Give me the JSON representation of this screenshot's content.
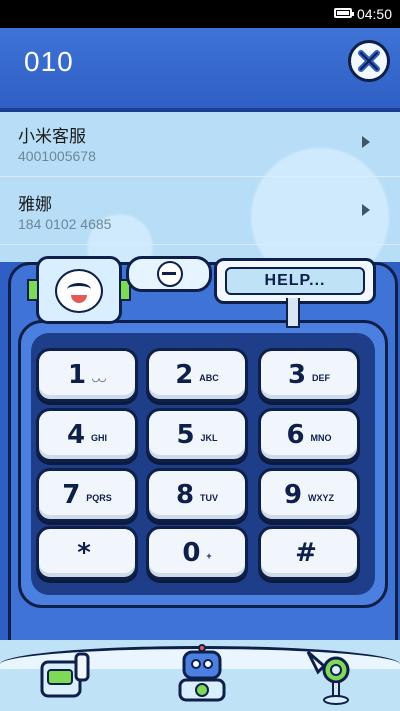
{
  "status_bar": {
    "time": "04:50"
  },
  "header": {
    "number": "010"
  },
  "contacts": [
    {
      "name": "小米客服",
      "phone": "4001005678"
    },
    {
      "name": "雅娜",
      "phone": "184 0102 4685"
    }
  ],
  "help_sign": {
    "text": "HELP..."
  },
  "keys": [
    {
      "digit": "1",
      "letters": "◡◡"
    },
    {
      "digit": "2",
      "letters": "ABC"
    },
    {
      "digit": "3",
      "letters": "DEF"
    },
    {
      "digit": "4",
      "letters": "GHI"
    },
    {
      "digit": "5",
      "letters": "JKL"
    },
    {
      "digit": "6",
      "letters": "MNO"
    },
    {
      "digit": "7",
      "letters": "PQRS"
    },
    {
      "digit": "8",
      "letters": "TUV"
    },
    {
      "digit": "9",
      "letters": "WXYZ"
    },
    {
      "digit": "*",
      "letters": ""
    },
    {
      "digit": "0",
      "letters": "+"
    },
    {
      "digit": "#",
      "letters": ""
    }
  ],
  "toolbar": {
    "dial_icon": "dial-robot-icon",
    "contacts_icon": "contacts-robot-icon",
    "log_icon": "call-log-robot-icon"
  },
  "colors": {
    "header_blue": "#3f73d6",
    "list_bg": "#b8ddf7",
    "outline": "#0e1f4a"
  }
}
